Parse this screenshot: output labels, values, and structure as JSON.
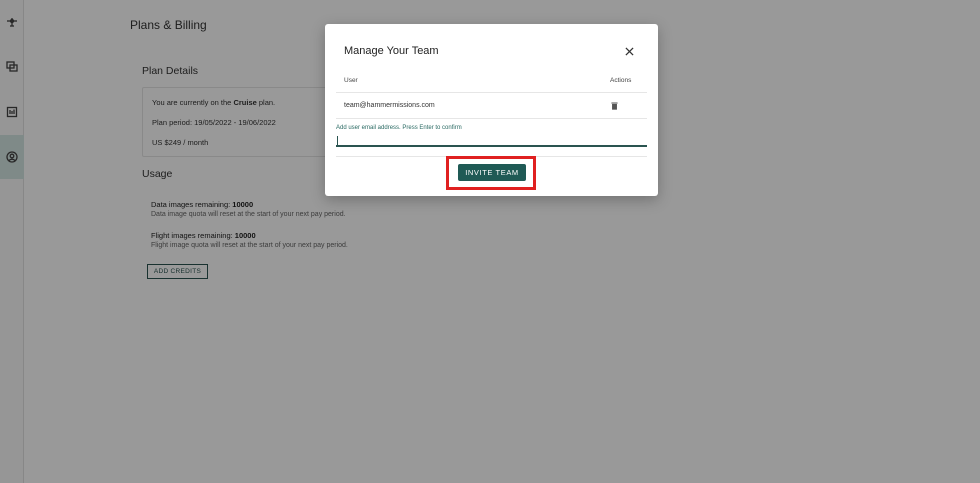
{
  "sidebar": {
    "items": [
      {
        "icon": "network-icon"
      },
      {
        "icon": "copy-icon"
      },
      {
        "icon": "document-icon"
      },
      {
        "icon": "user-circle-icon",
        "active": true
      }
    ]
  },
  "page": {
    "title": "Plans & Billing",
    "plan_details": {
      "heading": "Plan Details",
      "current_prefix": "You are currently on the ",
      "plan_name": "Cruise",
      "current_suffix": " plan.",
      "period": "Plan period: 19/05/2022 - 19/06/2022",
      "price": "US $249 / month"
    },
    "usage": {
      "heading": "Usage",
      "data_label": "Data images remaining: ",
      "data_value": "10000",
      "data_note": "Data image quota will reset at the start of your next pay period.",
      "flight_label": "Flight images remaining: ",
      "flight_value": "10000",
      "flight_note": "Flight image quota will reset at the start of your next pay period.",
      "add_credits_label": "ADD CREDITS"
    }
  },
  "modal": {
    "title": "Manage Your Team",
    "col_user": "User",
    "col_actions": "Actions",
    "members": [
      "team@hammermissions.com"
    ],
    "field_label": "Add user email address. Press Enter to confirm",
    "field_value": "",
    "invite_label": "INVITE TEAM"
  },
  "colors": {
    "accent": "#1f5a55",
    "highlight": "#e02020",
    "active_sidebar": "#d4e6e3"
  }
}
